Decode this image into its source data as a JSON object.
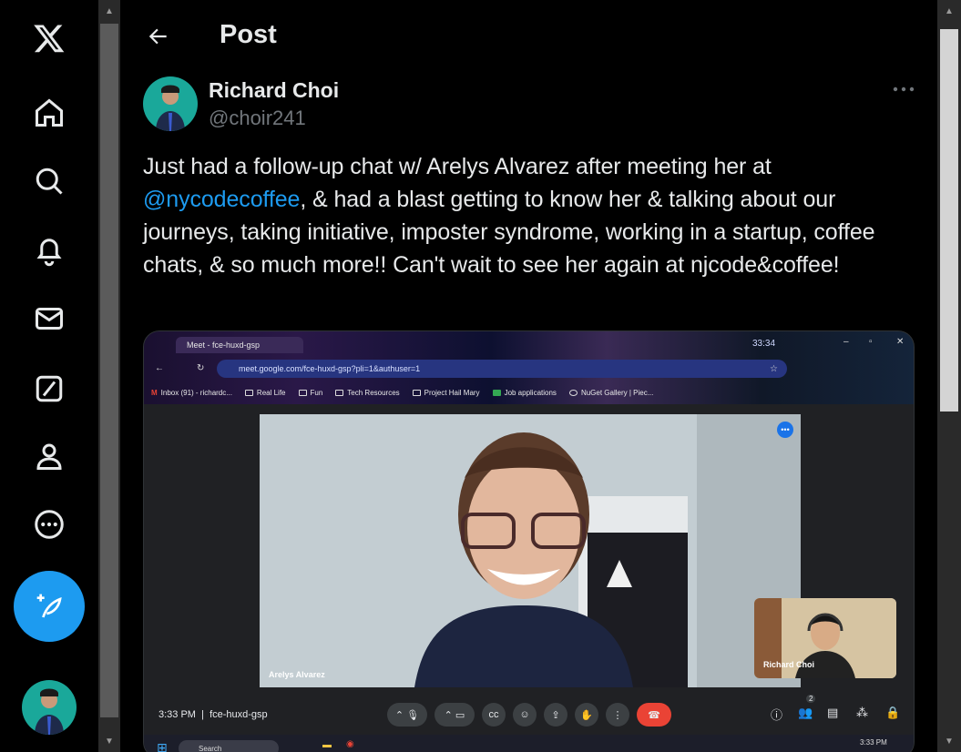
{
  "nav": {
    "items": [
      {
        "name": "x-logo-icon"
      },
      {
        "name": "home-icon"
      },
      {
        "name": "search-icon"
      },
      {
        "name": "notifications-icon"
      },
      {
        "name": "messages-icon"
      },
      {
        "name": "grok-icon"
      },
      {
        "name": "profile-icon"
      },
      {
        "name": "more-icon"
      }
    ],
    "compose_icon": "feather-plus-icon"
  },
  "header": {
    "title": "Post"
  },
  "post": {
    "author_name": "Richard Choi",
    "author_handle": "@choir241",
    "text_before": "Just had a follow-up chat w/ Arelys Alvarez after meeting her at ",
    "mention": "@nycodecoffee",
    "text_after": ", & had a blast getting to know her & talking about our journeys, taking initiative, imposter syndrome, working in a startup, coffee chats, & so much more!! Can't wait to see her again at njcode&coffee!"
  },
  "media": {
    "tab_title": "Meet - fce-huxd-gsp",
    "url": "meet.google.com/fce-huxd-gsp?pli=1&authuser=1",
    "clock": "33:34",
    "bookmarks": [
      "Inbox (91) - richardc...",
      "Real Life",
      "Fun",
      "Tech Resources",
      "Project Hail Mary",
      "Job applications",
      "NuGet Gallery | Piec..."
    ],
    "main_participant": "Arelys Alvarez",
    "self_participant": "Richard Choi",
    "meet_time": "3:33 PM",
    "meet_separator": "|",
    "meet_code": "fce-huxd-gsp",
    "people_count": "2",
    "taskbar_search": "Search",
    "taskbar_time": "3:33 PM"
  },
  "colors": {
    "accent": "#1d9bf0",
    "text": "#e7e9ea",
    "muted": "#71767b",
    "background": "#000000",
    "end_call": "#ea4335"
  }
}
